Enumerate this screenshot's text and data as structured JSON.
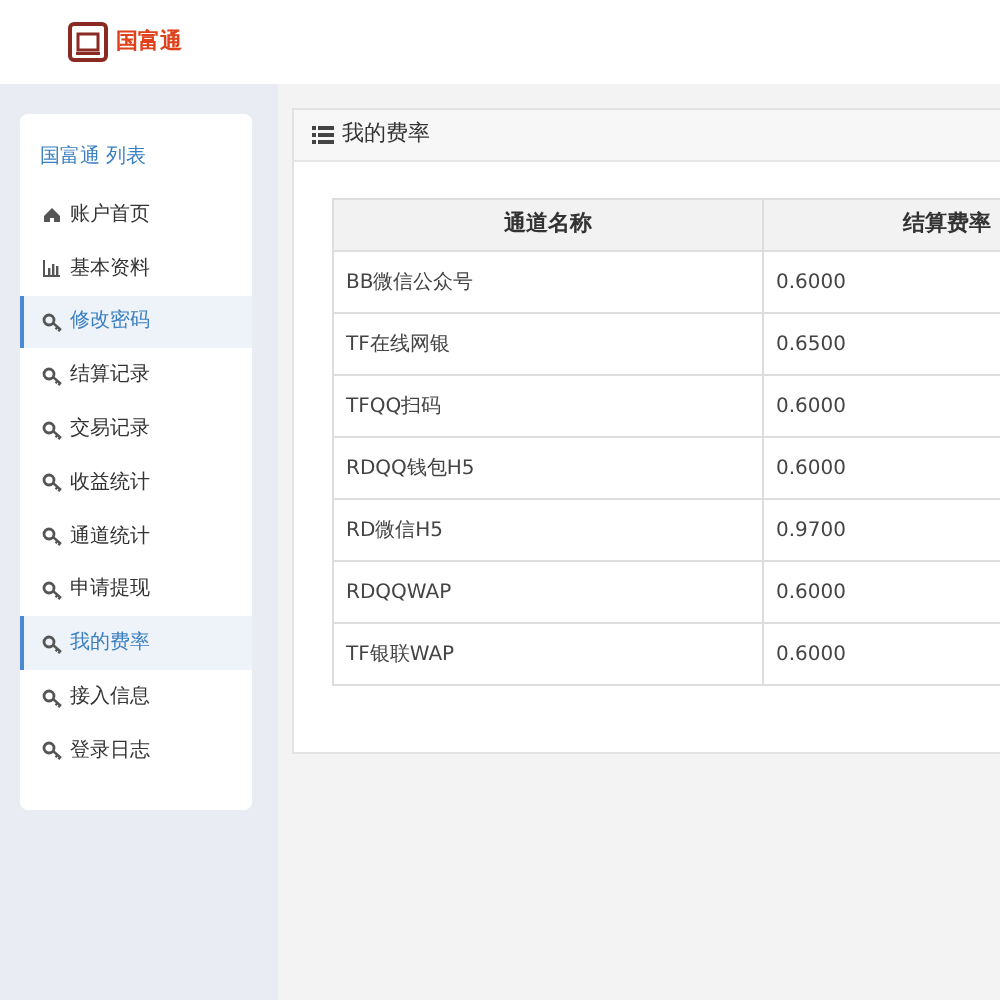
{
  "header": {
    "brand": "国富通"
  },
  "sidebar": {
    "title": "国富通 列表",
    "items": [
      {
        "label": "账户首页",
        "kind": "home",
        "selected": false
      },
      {
        "label": "基本资料",
        "kind": "chart",
        "selected": false
      },
      {
        "label": "修改密码",
        "kind": "key",
        "selected": true
      },
      {
        "label": "结算记录",
        "kind": "key",
        "selected": false
      },
      {
        "label": "交易记录",
        "kind": "key",
        "selected": false
      },
      {
        "label": "收益统计",
        "kind": "key",
        "selected": false
      },
      {
        "label": "通道统计",
        "kind": "key",
        "selected": false
      },
      {
        "label": "申请提现",
        "kind": "key",
        "selected": false
      },
      {
        "label": "我的费率",
        "kind": "key",
        "selected": true
      },
      {
        "label": "接入信息",
        "kind": "key",
        "selected": false
      },
      {
        "label": "登录日志",
        "kind": "key",
        "selected": false
      }
    ]
  },
  "panel": {
    "title": "我的费率",
    "table": {
      "columns": [
        "通道名称",
        "结算费率"
      ],
      "rows": [
        [
          "BB微信公众号",
          "0.6000"
        ],
        [
          "TF在线网银",
          "0.6500"
        ],
        [
          "TFQQ扫码",
          "0.6000"
        ],
        [
          "RDQQ钱包H5",
          "0.6000"
        ],
        [
          "RD微信H5",
          "0.9700"
        ],
        [
          "RDQQWAP",
          "0.6000"
        ],
        [
          "TF银联WAP",
          "0.6000"
        ]
      ]
    }
  }
}
